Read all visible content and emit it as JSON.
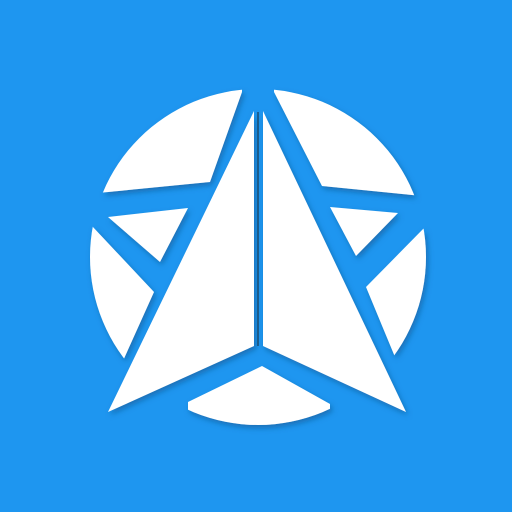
{
  "logo": {
    "icon": "compass-arrow-star-icon",
    "colors": {
      "background": "#1e96f0",
      "foreground": "#ffffff",
      "shadow": "#0a4f86"
    }
  }
}
